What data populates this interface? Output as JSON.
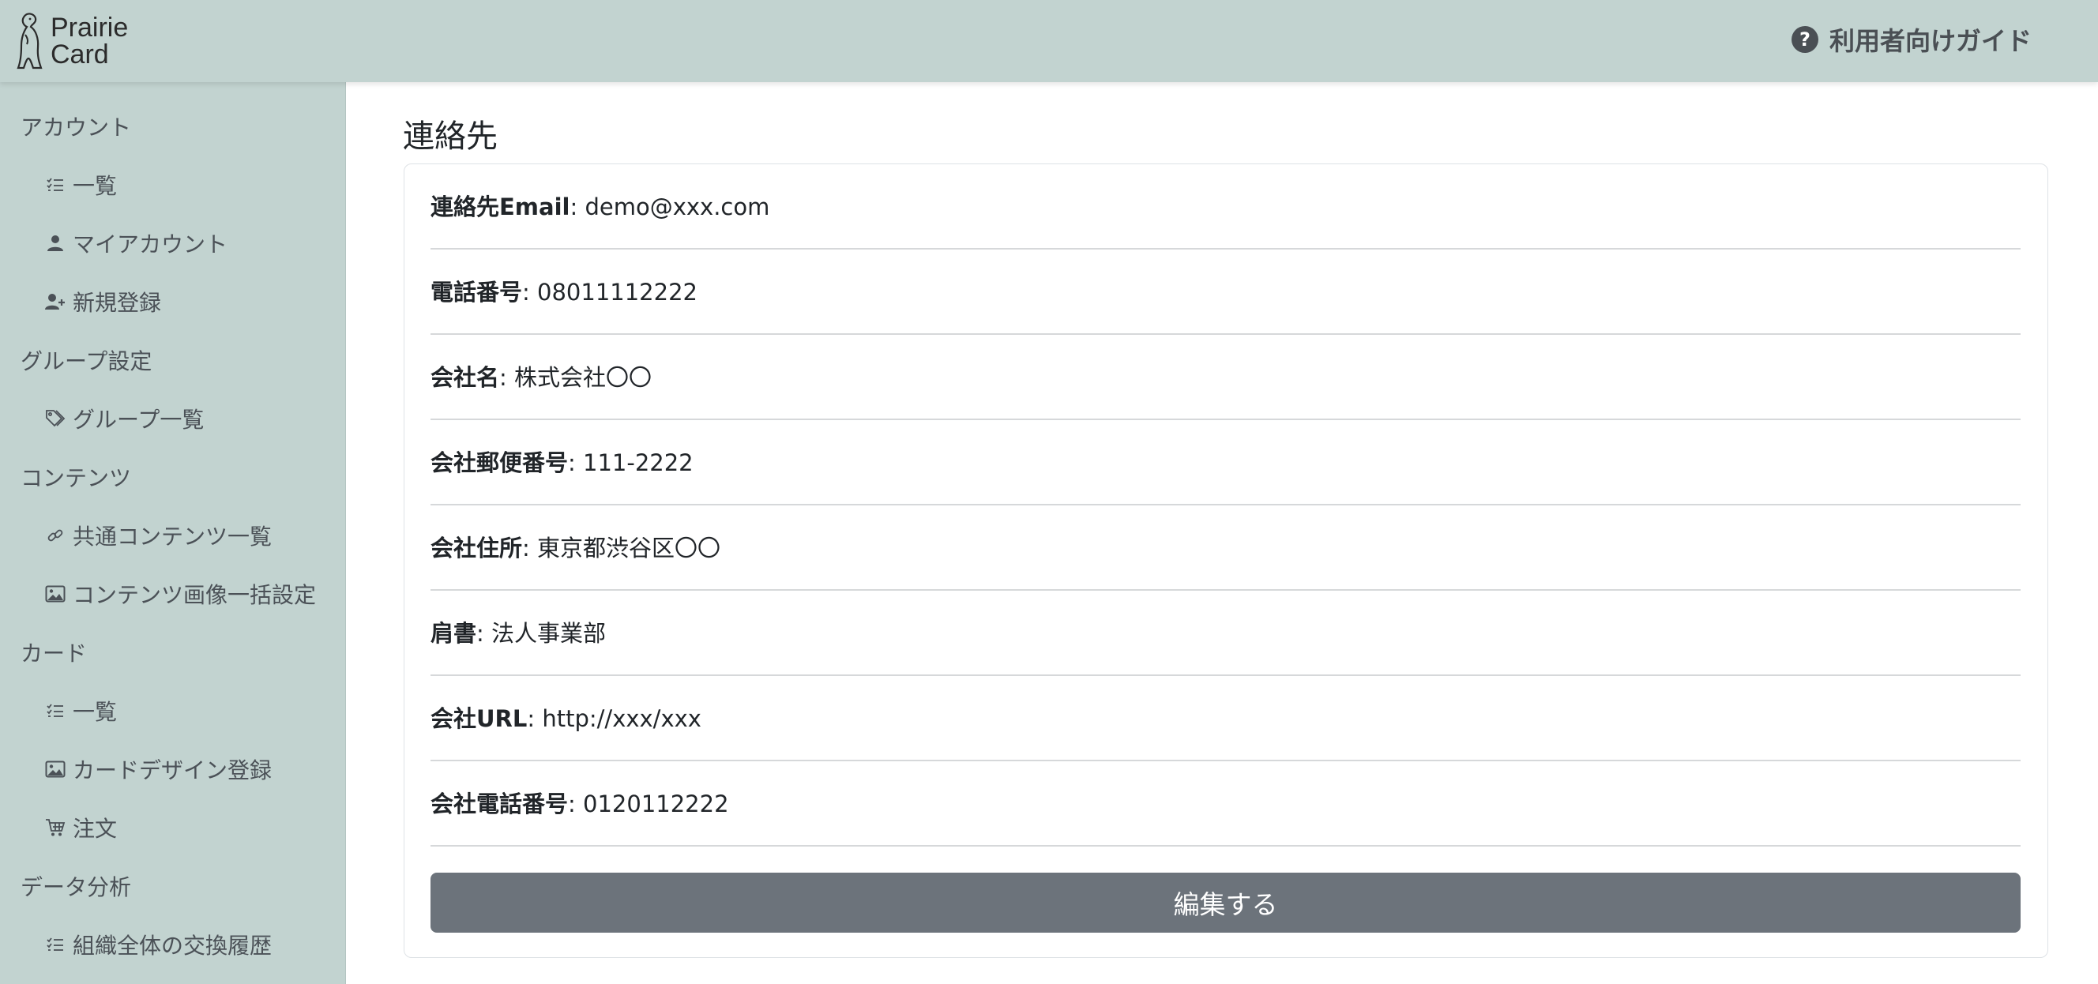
{
  "brand": {
    "line1": "Prairie",
    "line2": "Card"
  },
  "header": {
    "guide_label": "利用者向けガイド",
    "guide_icon": "?"
  },
  "sidebar": {
    "sections": [
      {
        "label": "アカウント",
        "items": [
          {
            "label": "一覧",
            "icon": "list-icon"
          },
          {
            "label": "マイアカウント",
            "icon": "person-icon"
          },
          {
            "label": "新規登録",
            "icon": "person-add-icon"
          }
        ]
      },
      {
        "label": "グループ設定",
        "items": [
          {
            "label": "グループ一覧",
            "icon": "tags-icon"
          }
        ]
      },
      {
        "label": "コンテンツ",
        "items": [
          {
            "label": "共通コンテンツ一覧",
            "icon": "link-icon"
          },
          {
            "label": "コンテンツ画像一括設定",
            "icon": "image-icon"
          }
        ]
      },
      {
        "label": "カード",
        "items": [
          {
            "label": "一覧",
            "icon": "list-icon"
          },
          {
            "label": "カードデザイン登録",
            "icon": "image-icon"
          },
          {
            "label": "注文",
            "icon": "cart-icon"
          }
        ]
      },
      {
        "label": "データ分析",
        "items": [
          {
            "label": "組織全体の交換履歴",
            "icon": "list-icon"
          }
        ]
      }
    ]
  },
  "main": {
    "title": "連絡先",
    "fields": [
      {
        "label": "連絡先Email",
        "value": "demo@xxx.com"
      },
      {
        "label": "電話番号",
        "value": "08011112222"
      },
      {
        "label": "会社名",
        "value": "株式会社〇〇"
      },
      {
        "label": "会社郵便番号",
        "value": "111-2222"
      },
      {
        "label": "会社住所",
        "value": "東京都渋谷区〇〇"
      },
      {
        "label": "肩書",
        "value": "法人事業部"
      },
      {
        "label": "会社URL",
        "value": "http://xxx/xxx"
      },
      {
        "label": "会社電話番号",
        "value": "0120112222"
      }
    ],
    "edit_label": "編集する"
  }
}
